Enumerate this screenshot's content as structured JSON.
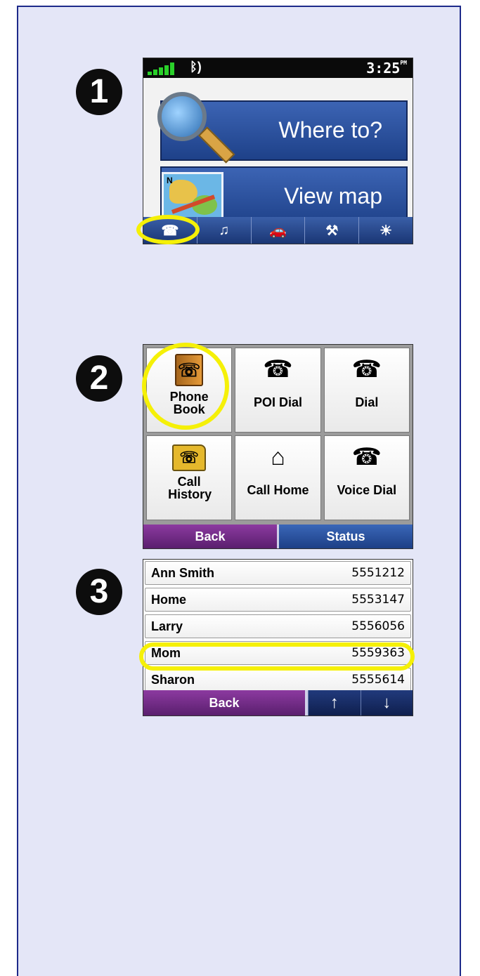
{
  "step1": {
    "badge": "1",
    "status": {
      "time": "3:25",
      "ampm": "PM"
    },
    "buttons": {
      "where_to": "Where to?",
      "view_map": "View map"
    },
    "tabs": [
      "phone-icon",
      "music-icon",
      "traffic-icon",
      "tools-icon",
      "brightness-icon"
    ]
  },
  "step2": {
    "badge": "2",
    "cells": [
      {
        "label": "Phone Book"
      },
      {
        "label": "POI Dial"
      },
      {
        "label": "Dial"
      },
      {
        "label": "Call History"
      },
      {
        "label": "Call Home"
      },
      {
        "label": "Voice Dial"
      }
    ],
    "back": "Back",
    "status": "Status"
  },
  "step3": {
    "badge": "3",
    "contacts": [
      {
        "name": "Ann Smith",
        "number": "5551212"
      },
      {
        "name": "Home",
        "number": "5553147"
      },
      {
        "name": "Larry",
        "number": "5556056"
      },
      {
        "name": "Mom",
        "number": "5559363"
      },
      {
        "name": "Sharon",
        "number": "5555614"
      }
    ],
    "back": "Back"
  },
  "colors": {
    "highlight": "#f5f007",
    "frame_bg": "#e4e6f7",
    "frame_border": "#1d2a8a"
  }
}
